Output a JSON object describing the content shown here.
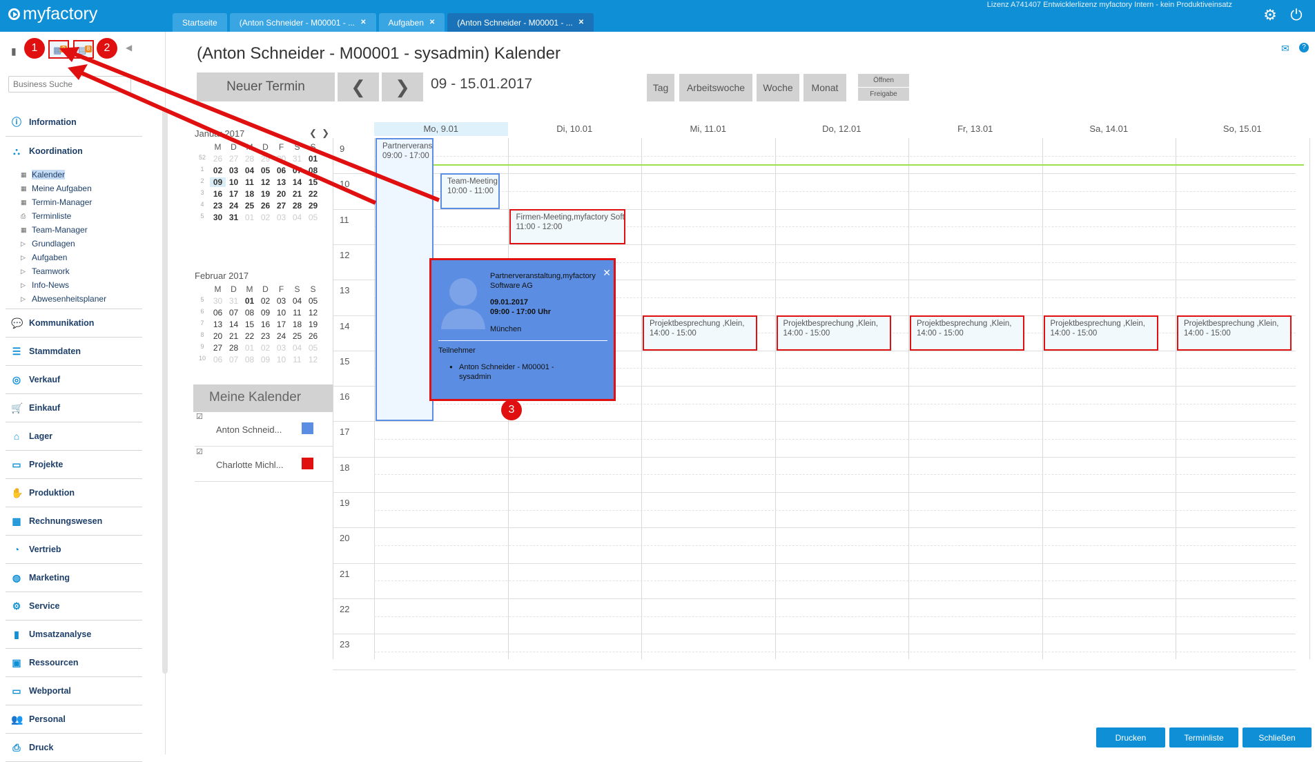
{
  "app": {
    "logo": "myfactory",
    "license": "Lizenz A741407 Entwicklerlizenz myfactory Intern - kein Produktiveinsatz"
  },
  "tabs": [
    {
      "label": "Startseite",
      "closable": false
    },
    {
      "label": "(Anton Schneider - M00001 - ...",
      "closable": true
    },
    {
      "label": "Aufgaben",
      "closable": true
    },
    {
      "label": "(Anton Schneider - M00001 - ...",
      "closable": true,
      "active": true
    }
  ],
  "sidebar": {
    "toolbar_badges": {
      "calendar": "2",
      "tasks": "8"
    },
    "search_placeholder": "Business Suche",
    "items": [
      {
        "label": "Information",
        "icon": "info-icon"
      },
      {
        "label": "Koordination",
        "icon": "network-icon"
      },
      {
        "label": "Kommunikation",
        "icon": "chat-icon"
      },
      {
        "label": "Stammdaten",
        "icon": "database-icon"
      },
      {
        "label": "Verkauf",
        "icon": "coins-icon"
      },
      {
        "label": "Einkauf",
        "icon": "cart-icon"
      },
      {
        "label": "Lager",
        "icon": "warehouse-icon"
      },
      {
        "label": "Projekte",
        "icon": "presentation-icon"
      },
      {
        "label": "Produktion",
        "icon": "hand-icon"
      },
      {
        "label": "Rechnungswesen",
        "icon": "grid-icon"
      },
      {
        "label": "Vertrieb",
        "icon": "gauge-icon"
      },
      {
        "label": "Marketing",
        "icon": "globe-icon"
      },
      {
        "label": "Service",
        "icon": "gear-icon"
      },
      {
        "label": "Umsatzanalyse",
        "icon": "bar-chart-icon"
      },
      {
        "label": "Ressourcen",
        "icon": "box-icon"
      },
      {
        "label": "Webportal",
        "icon": "monitor-icon"
      },
      {
        "label": "Personal",
        "icon": "people-icon"
      },
      {
        "label": "Druck",
        "icon": "printer-icon"
      }
    ],
    "sub_items": [
      {
        "label": "Kalender",
        "icon": "calendar-icon",
        "selected": true
      },
      {
        "label": "Meine Aufgaben",
        "icon": "calendar-icon"
      },
      {
        "label": "Termin-Manager",
        "icon": "calendar-icon"
      },
      {
        "label": "Terminliste",
        "icon": "printer-icon"
      },
      {
        "label": "Team-Manager",
        "icon": "calendar-icon"
      },
      {
        "label": "Grundlagen",
        "icon": "triangle-icon"
      },
      {
        "label": "Aufgaben",
        "icon": "triangle-icon"
      },
      {
        "label": "Teamwork",
        "icon": "triangle-icon"
      },
      {
        "label": "Info-News",
        "icon": "triangle-icon"
      },
      {
        "label": "Abwesenheitsplaner",
        "icon": "triangle-icon"
      }
    ]
  },
  "page": {
    "title": "(Anton Schneider - M00001 - sysadmin) Kalender",
    "new_button": "Neuer Termin",
    "date_range": "09 - 15.01.2017",
    "views": [
      "Tag",
      "Arbeitswoche",
      "Woche",
      "Monat"
    ],
    "small_buttons": [
      "Öffnen",
      "Freigabe"
    ]
  },
  "mini_calendars": [
    {
      "title": "Januar 2017",
      "weekdays": [
        "M",
        "D",
        "M",
        "D",
        "F",
        "S",
        "S"
      ],
      "weeks": [
        {
          "wk": "52",
          "days": [
            [
              "26",
              "o"
            ],
            [
              "27",
              "o"
            ],
            [
              "28",
              "o"
            ],
            [
              "29",
              "o"
            ],
            [
              "30",
              "o"
            ],
            [
              "31",
              "o"
            ],
            [
              "01",
              "b"
            ]
          ]
        },
        {
          "wk": "1",
          "days": [
            [
              "02",
              "b"
            ],
            [
              "03",
              "b"
            ],
            [
              "04",
              "b"
            ],
            [
              "05",
              "b"
            ],
            [
              "06",
              "b"
            ],
            [
              "07",
              "b"
            ],
            [
              "08",
              "b"
            ]
          ]
        },
        {
          "wk": "2",
          "days": [
            [
              "09",
              "t"
            ],
            [
              "10",
              "b"
            ],
            [
              "11",
              "b"
            ],
            [
              "12",
              "b"
            ],
            [
              "13",
              "b"
            ],
            [
              "14",
              "b"
            ],
            [
              "15",
              "b"
            ]
          ]
        },
        {
          "wk": "3",
          "days": [
            [
              "16",
              "b"
            ],
            [
              "17",
              "b"
            ],
            [
              "18",
              "b"
            ],
            [
              "19",
              "b"
            ],
            [
              "20",
              "b"
            ],
            [
              "21",
              "b"
            ],
            [
              "22",
              "b"
            ]
          ]
        },
        {
          "wk": "4",
          "days": [
            [
              "23",
              "b"
            ],
            [
              "24",
              "b"
            ],
            [
              "25",
              "b"
            ],
            [
              "26",
              "b"
            ],
            [
              "27",
              "b"
            ],
            [
              "28",
              "b"
            ],
            [
              "29",
              "b"
            ]
          ]
        },
        {
          "wk": "5",
          "days": [
            [
              "30",
              "b"
            ],
            [
              "31",
              "b"
            ],
            [
              "01",
              "o"
            ],
            [
              "02",
              "o"
            ],
            [
              "03",
              "o"
            ],
            [
              "04",
              "o"
            ],
            [
              "05",
              "o"
            ]
          ]
        }
      ]
    },
    {
      "title": "Februar 2017",
      "weekdays": [
        "M",
        "D",
        "M",
        "D",
        "F",
        "S",
        "S"
      ],
      "weeks": [
        {
          "wk": "5",
          "days": [
            [
              "30",
              "o"
            ],
            [
              "31",
              "o"
            ],
            [
              "01",
              "b"
            ],
            [
              "02",
              ""
            ],
            [
              "03",
              ""
            ],
            [
              "04",
              ""
            ],
            [
              "05",
              ""
            ]
          ]
        },
        {
          "wk": "6",
          "days": [
            [
              "06",
              ""
            ],
            [
              "07",
              ""
            ],
            [
              "08",
              ""
            ],
            [
              "09",
              ""
            ],
            [
              "10",
              ""
            ],
            [
              "11",
              ""
            ],
            [
              "12",
              ""
            ]
          ]
        },
        {
          "wk": "7",
          "days": [
            [
              "13",
              ""
            ],
            [
              "14",
              ""
            ],
            [
              "15",
              ""
            ],
            [
              "16",
              ""
            ],
            [
              "17",
              ""
            ],
            [
              "18",
              ""
            ],
            [
              "19",
              ""
            ]
          ]
        },
        {
          "wk": "8",
          "days": [
            [
              "20",
              ""
            ],
            [
              "21",
              ""
            ],
            [
              "22",
              ""
            ],
            [
              "23",
              ""
            ],
            [
              "24",
              ""
            ],
            [
              "25",
              ""
            ],
            [
              "26",
              ""
            ]
          ]
        },
        {
          "wk": "9",
          "days": [
            [
              "27",
              ""
            ],
            [
              "28",
              ""
            ],
            [
              "01",
              "o"
            ],
            [
              "02",
              "o"
            ],
            [
              "03",
              "o"
            ],
            [
              "04",
              "o"
            ],
            [
              "05",
              "o"
            ]
          ]
        },
        {
          "wk": "10",
          "days": [
            [
              "06",
              "o"
            ],
            [
              "07",
              "o"
            ],
            [
              "08",
              "o"
            ],
            [
              "09",
              "o"
            ],
            [
              "10",
              "o"
            ],
            [
              "11",
              "o"
            ],
            [
              "12",
              "o"
            ]
          ]
        }
      ]
    }
  ],
  "my_calendars": {
    "title": "Meine Kalender",
    "items": [
      {
        "label": "Anton Schneid...",
        "checked": true,
        "color": "#5b8ee2"
      },
      {
        "label": "Charlotte Michl...",
        "checked": true,
        "color": "#e01010"
      }
    ]
  },
  "calendar": {
    "days": [
      "Mo, 9.01",
      "Di, 10.01",
      "Mi, 11.01",
      "Do, 12.01",
      "Fr, 13.01",
      "Sa, 14.01",
      "So, 15.01"
    ],
    "hours": [
      "9",
      "10",
      "11",
      "12",
      "13",
      "14",
      "15",
      "16",
      "17",
      "18",
      "19",
      "20",
      "21",
      "22",
      "23"
    ],
    "events": [
      {
        "title": "Partnerveranstaltung,myfactory Software AG",
        "time": "09:00 - 17:00",
        "day": 0,
        "start": 9,
        "end": 17,
        "style": "blue"
      },
      {
        "title": "Team-Meeting",
        "time": "10:00 - 11:00",
        "day": 0,
        "start": 10,
        "end": 11,
        "style": "blue"
      },
      {
        "title": "Firmen-Meeting,myfactory Software AG",
        "time": "11:00 - 12:00",
        "day": 1,
        "start": 11,
        "end": 12,
        "style": "red"
      },
      {
        "title": "Projektbesprechung ,Klein,",
        "time": "14:00 - 15:00",
        "day": 2,
        "start": 14,
        "end": 15,
        "style": "red"
      },
      {
        "title": "Projektbesprechung ,Klein,",
        "time": "14:00 - 15:00",
        "day": 3,
        "start": 14,
        "end": 15,
        "style": "red"
      },
      {
        "title": "Projektbesprechung ,Klein,",
        "time": "14:00 - 15:00",
        "day": 4,
        "start": 14,
        "end": 15,
        "style": "red"
      },
      {
        "title": "Projektbesprechung ,Klein,",
        "time": "14:00 - 15:00",
        "day": 5,
        "start": 14,
        "end": 15,
        "style": "red"
      },
      {
        "title": "Projektbesprechung ,Klein,",
        "time": "14:00 - 15:00",
        "day": 6,
        "start": 14,
        "end": 15,
        "style": "red"
      }
    ]
  },
  "popup": {
    "title": "Partnerveranstaltung,myfactory Software AG",
    "date": "09.01.2017",
    "time": "09:00 - 17:00 Uhr",
    "location": "München",
    "participants_label": "Teilnehmer",
    "participants": [
      "Anton Schneider - M00001 - sysadmin"
    ]
  },
  "footer": {
    "buttons": [
      "Drucken",
      "Terminliste",
      "Schließen"
    ]
  },
  "annotations": [
    "1",
    "2",
    "3"
  ],
  "colors": {
    "brand": "#0f8fd6",
    "highlight": "#e01010",
    "event_blue": "#5b8ee2",
    "now_line": "#9be24a"
  }
}
